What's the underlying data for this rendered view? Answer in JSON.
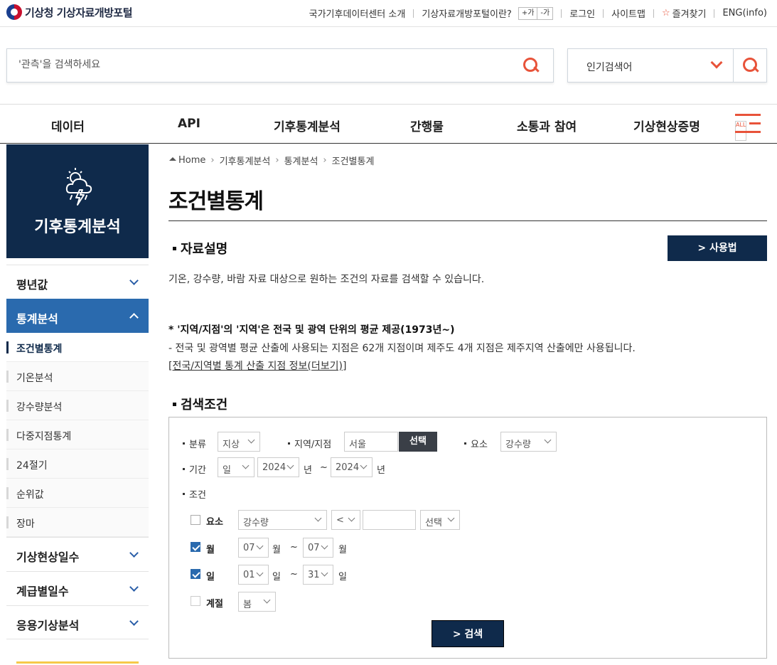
{
  "header": {
    "logo_text": "기상청 기상자료개방포털",
    "util_links": [
      "국가기후데이터센터 소개",
      "기상자료개방포털이란?"
    ],
    "font_plus": "+가",
    "font_minus": "-가",
    "util_links2": [
      "로그인",
      "사이트맵",
      "즐겨찾기",
      "ENG(info)"
    ]
  },
  "search": {
    "placeholder": "'관측'을 검색하세요",
    "popular_label": "인기검색어"
  },
  "gnb": {
    "items": [
      "데이터",
      "API",
      "기후통계분석",
      "간행물",
      "소통과 참여",
      "기상현상증명"
    ],
    "all_label": "ALL"
  },
  "lnb": {
    "title": "기후통계분석",
    "groups_top": [
      "평년값",
      "통계분석"
    ],
    "subs": [
      "조건별통계",
      "기온분석",
      "강수량분석",
      "다중지점통계",
      "24절기",
      "순위값",
      "장마"
    ],
    "groups_bottom": [
      "기상현상일수",
      "계급별일수",
      "응용기상분석"
    ]
  },
  "breadcrumb": [
    "Home",
    "기후통계분석",
    "통계분석",
    "조건별통계"
  ],
  "page_title": "조건별통계",
  "section1": {
    "heading": "자료설명",
    "howto_button": "> 사용법",
    "description": "기온, 강수량, 바람 자료 대상으로 원하는 조건의 자료를 검색할 수 있습니다.",
    "note_bold": "* '지역/지점'의 '지역'은 전국 및 광역 단위의 평균 제공(1973년~)",
    "note_text": "- 전국 및 광역별 평균 산출에 사용되는 지점은 62개 지점이며 제주도 4개 지점은 제주지역 산출에만 사용됩니다.",
    "note_link": "[전국/지역별 통계 산출 지점 정보(더보기)]"
  },
  "section2": {
    "heading": "검색조건",
    "class_label": "분류",
    "class_value": "지상",
    "region_label": "지역/지점",
    "region_value": "서울",
    "region_button": "선택",
    "element_label": "요소",
    "element_value": "강수량",
    "period_label": "기간",
    "period_unit": "일",
    "year_from": "2024",
    "year_to": "2024",
    "year_unit": "년",
    "tilde": "~",
    "condition_label": "조건",
    "cond_element_label": "요소",
    "cond_element_value": "강수량",
    "cond_op": "<",
    "cond_select": "선택",
    "month_label": "월",
    "month_from": "07",
    "month_to": "07",
    "month_unit": "월",
    "day_label": "일",
    "day_from": "01",
    "day_to": "31",
    "day_unit": "일",
    "season_label": "계절",
    "season_value": "봄",
    "search_button": "> 검색"
  },
  "colors": {
    "navy": "#0f2a4b",
    "accent": "#e8533a",
    "active_blue": "#2a6aae"
  }
}
